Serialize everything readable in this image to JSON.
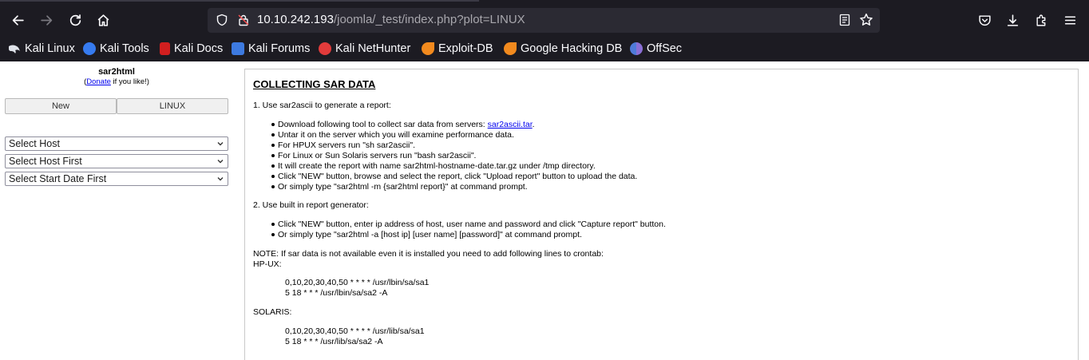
{
  "browser": {
    "url_host": "10.10.242.193",
    "url_path": "/joomla/_test/index.php?plot=LINUX",
    "bookmarks": [
      {
        "label": "Kali Linux",
        "icon": "kali-dragon-icon"
      },
      {
        "label": "Kali Tools",
        "icon": "kali-tools-icon"
      },
      {
        "label": "Kali Docs",
        "icon": "kali-docs-icon"
      },
      {
        "label": "Kali Forums",
        "icon": "kali-forums-icon"
      },
      {
        "label": "Kali NetHunter",
        "icon": "nethunter-icon"
      },
      {
        "label": "Exploit-DB",
        "icon": "exploit-db-icon"
      },
      {
        "label": "Google Hacking DB",
        "icon": "ghdb-icon"
      },
      {
        "label": "OffSec",
        "icon": "offsec-icon"
      }
    ]
  },
  "sidebar": {
    "title": "sar2html",
    "donate_prefix": "(",
    "donate_link": "Donate",
    "donate_suffix": " if you like!)",
    "buttons": {
      "new": "New",
      "os": "LINUX"
    },
    "selects": {
      "host": "Select Host",
      "host_first": "Select Host First",
      "start_date_first": "Select Start Date First"
    }
  },
  "content": {
    "heading": "COLLECTING SAR DATA",
    "step1": "1. Use sar2ascii to generate a report:",
    "step1_bullets": {
      "b1_prefix": "Download following tool to collect sar data from servers: ",
      "b1_link": "sar2ascii.tar",
      "b1_suffix": ".",
      "b2": "Untar it on the server which you will examine performance data.",
      "b3": "For HPUX servers run \"sh sar2ascii\".",
      "b4": "For Linux or Sun Solaris servers run \"bash sar2ascii\".",
      "b5": "It will create the report with name sar2html-hostname-date.tar.gz under /tmp directory.",
      "b6": "Click \"NEW\" button, browse and select the report, click \"Upload report\" button to upload the data.",
      "b7": "Or simply type \"sar2html -m {sar2html report}\" at command prompt."
    },
    "step2": "2. Use built in report generator:",
    "step2_bullets": {
      "b1": "Click \"NEW\" button, enter ip address of host, user name and password and click \"Capture report\" button.",
      "b2": "Or simply type \"sar2html -a [host ip] [user name] [password]\" at command prompt."
    },
    "note": "NOTE: If sar data is not available even it is installed you need to add following lines to crontab:",
    "hpux_label": "HP-UX:",
    "hpux_lines": [
      "0,10,20,30,40,50 * * * * /usr/lbin/sa/sa1",
      "5 18 * * * /usr/lbin/sa/sa2 -A"
    ],
    "solaris_label": "SOLARIS:",
    "solaris_lines": [
      "0,10,20,30,40,50 * * * * /usr/lib/sa/sa1",
      "5 18 * * * /usr/lib/sa/sa2 -A"
    ]
  }
}
